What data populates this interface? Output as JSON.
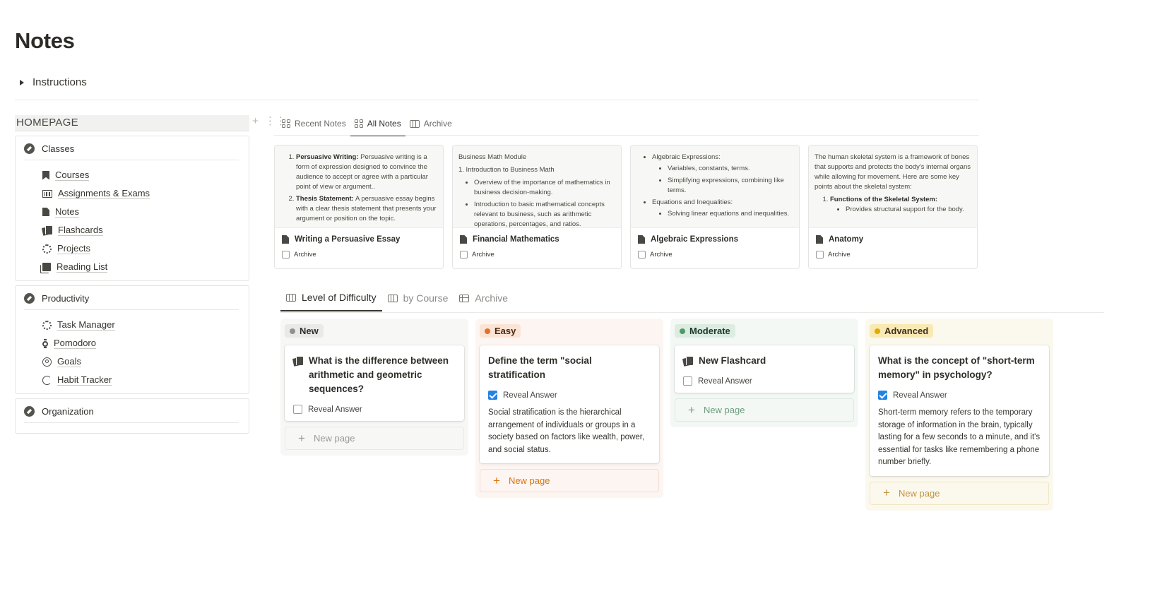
{
  "page": {
    "title": "Notes"
  },
  "instructions": {
    "label": "Instructions"
  },
  "sidebar": {
    "title": "HOMEPAGE",
    "sections": [
      {
        "label": "Classes",
        "items": [
          {
            "label": "Courses",
            "icon": "bookmark-icon"
          },
          {
            "label": "Assignments & Exams",
            "icon": "calendar-icon"
          },
          {
            "label": "Notes",
            "icon": "document-icon"
          },
          {
            "label": "Flashcards",
            "icon": "flashcards-icon"
          },
          {
            "label": "Projects",
            "icon": "atom-icon"
          },
          {
            "label": "Reading List",
            "icon": "books-icon"
          }
        ]
      },
      {
        "label": "Productivity",
        "items": [
          {
            "label": "Task Manager",
            "icon": "gear-icon"
          },
          {
            "label": "Pomodoro",
            "icon": "watch-icon"
          },
          {
            "label": "Goals",
            "icon": "target-icon"
          },
          {
            "label": "Habit Tracker",
            "icon": "cycle-icon"
          }
        ]
      },
      {
        "label": "Organization",
        "items": []
      }
    ]
  },
  "notes_views": {
    "tabs": [
      {
        "label": "Recent Notes",
        "icon": "gallery-icon",
        "active": false
      },
      {
        "label": "All Notes",
        "icon": "gallery-icon",
        "active": true
      },
      {
        "label": "Archive",
        "icon": "board-icon",
        "active": false
      }
    ],
    "cards": [
      {
        "title": "Writing a Persuasive Essay",
        "archive_label": "Archive",
        "preview": {
          "item1_bold": "Persuasive Writing:",
          "item1_text": " Persuasive writing is a form of expression designed to convince the audience to accept or agree with a particular point of view or argument..",
          "item2_bold": "Thesis Statement:",
          "item2_text": " A persuasive essay begins with a clear thesis statement that presents your argument or position on the topic."
        }
      },
      {
        "title": "Financial Mathematics",
        "archive_label": "Archive",
        "preview": {
          "heading": "Business Math Module",
          "subheading": "1. Introduction to Business Math",
          "bullet1": "Overview of the importance of mathematics in business decision-making.",
          "bullet2": "Introduction to basic mathematical concepts relevant to business, such as arithmetic operations, percentages, and ratios."
        }
      },
      {
        "title": "Algebraic Expressions",
        "archive_label": "Archive",
        "preview": {
          "bullet1": "Algebraic Expressions:",
          "sub1": "Variables, constants, terms.",
          "sub2": "Simplifying expressions, combining like terms.",
          "bullet2": "Equations and Inequalities:",
          "sub3": "Solving linear equations and inequalities."
        }
      },
      {
        "title": "Anatomy",
        "archive_label": "Archive",
        "preview": {
          "para": "The human skeletal system is a framework of bones that supports and protects the body's internal organs while allowing for movement. Here are some key points about the skeletal system:",
          "item1": "Functions of the Skeletal System:",
          "sub1": "Provides structural support for the body."
        }
      }
    ]
  },
  "flash_views": {
    "tabs": [
      {
        "label": "Level of Difficulty",
        "icon": "board-icon",
        "active": true
      },
      {
        "label": "by Course",
        "icon": "board-icon",
        "active": false
      },
      {
        "label": "Archive",
        "icon": "table-icon",
        "active": false
      }
    ],
    "columns": [
      {
        "label": "New",
        "pill_bg": "#e9e9e7",
        "dot": "#91918e",
        "pill_color": "#32302c",
        "cards": [
          {
            "title": "What is the difference between arithmetic and geometric sequences?",
            "reveal_label": "Reveal Answer",
            "checked": false,
            "answer": "",
            "icon": true
          }
        ],
        "new_label": "New page"
      },
      {
        "label": "Easy",
        "pill_bg": "#fbe4d6",
        "dot": "#e16f2d",
        "pill_color": "#49290e",
        "cards": [
          {
            "title": "Define the term \"social stratification",
            "reveal_label": "Reveal Answer",
            "checked": true,
            "answer": "Social stratification is the hierarchical arrangement of individuals or groups in a society based on factors like wealth, power, and social status.",
            "icon": false
          }
        ],
        "new_label": "New page"
      },
      {
        "label": "Moderate",
        "pill_bg": "#dcece1",
        "dot": "#4e9a69",
        "pill_color": "#1c3829",
        "cards": [
          {
            "title": "New Flashcard",
            "reveal_label": "Reveal Answer",
            "checked": false,
            "answer": "",
            "icon": true
          }
        ],
        "new_label": "New page"
      },
      {
        "label": "Advanced",
        "pill_bg": "#f9e9b3",
        "dot": "#dfab01",
        "pill_color": "#402c1b",
        "cards": [
          {
            "title": "What is the concept of \"short-term memory\" in psychology?",
            "reveal_label": "Reveal Answer",
            "checked": true,
            "answer": "Short-term memory refers to the temporary storage of information in the brain, typically lasting for a few seconds to a minute, and it's essential for tasks like remembering a phone number briefly.",
            "icon": false
          }
        ],
        "new_label": "New page"
      }
    ]
  }
}
